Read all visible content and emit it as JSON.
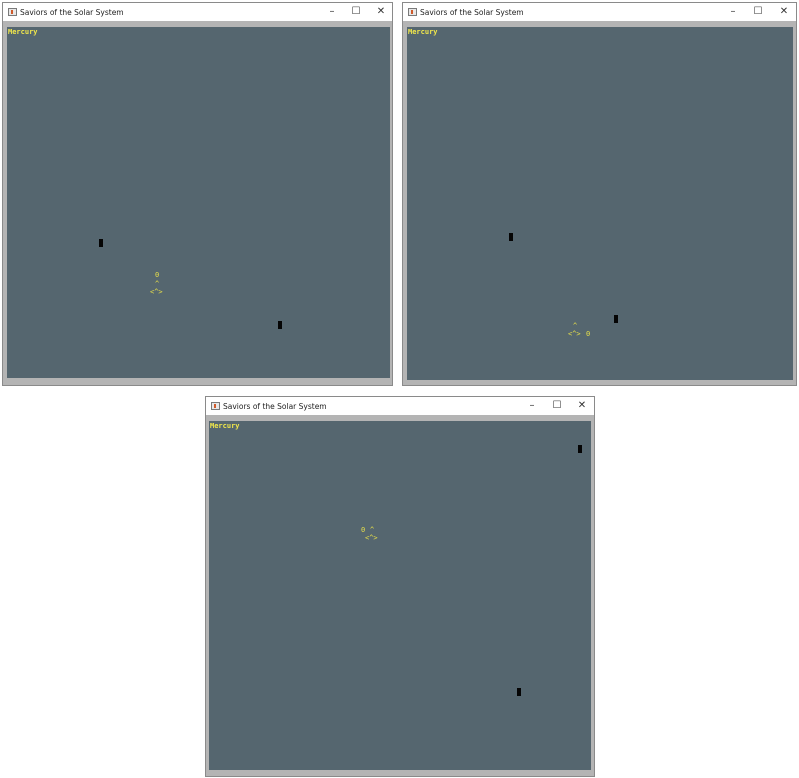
{
  "window_title": "Saviors of the Solar System",
  "controls": {
    "minimize": "–",
    "maximize": "☐",
    "close": "✕"
  },
  "level": "Mercury",
  "ship": {
    "nose": "^",
    "body": "<^>",
    "bullet": "0"
  },
  "colors": {
    "canvas": "#55666f",
    "text": "#f2e84a",
    "enemy": "#050505"
  }
}
